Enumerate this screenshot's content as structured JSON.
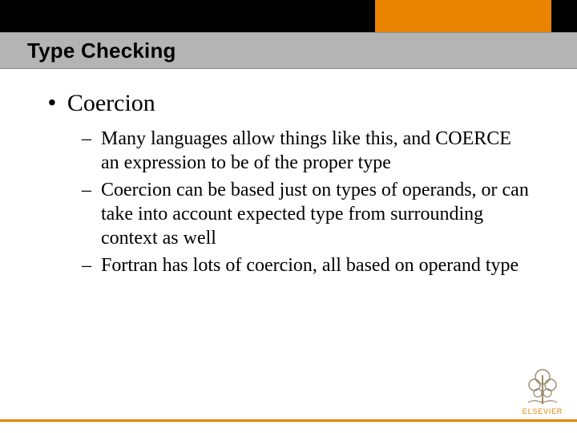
{
  "colors": {
    "accent": "#e98300",
    "titlebar": "#b4b4b4"
  },
  "title": "Type Checking",
  "bullet": {
    "label": "Coercion",
    "children": [
      "Many languages allow things like this, and COERCE an expression to be of the proper type",
      "Coercion can be based just on types of operands, or can take into account expected type from surrounding context as well",
      "Fortran has lots of coercion, all based on operand type"
    ]
  },
  "brand": "ELSEVIER"
}
